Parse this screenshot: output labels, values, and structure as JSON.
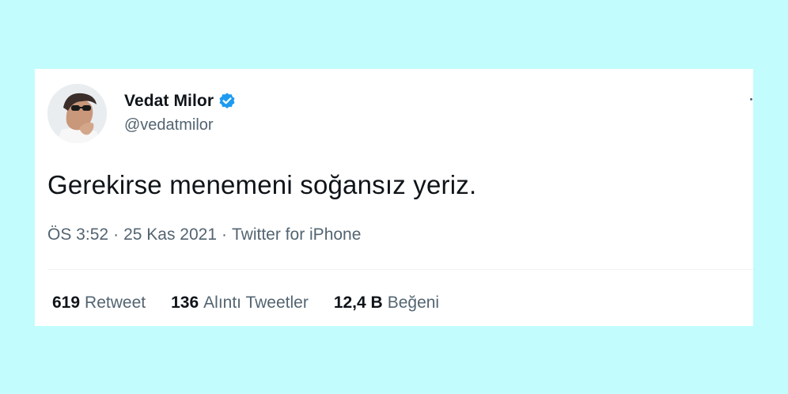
{
  "colors": {
    "page_background": "#c2fcfd",
    "card_background": "#ffffff",
    "text_primary": "#0f1419",
    "text_secondary": "#536471",
    "verified_badge": "#1d9bf0"
  },
  "tweet": {
    "author": {
      "display_name": "Vedat Milor",
      "handle": "@vedatmilor",
      "verified": true,
      "avatar_icon": "profile-photo"
    },
    "text": "Gerekirse menemeni soğansız yeriz.",
    "meta": {
      "time": "ÖS 3:52",
      "separator": "·",
      "date": "25 Kas 2021",
      "source": "Twitter for iPhone"
    },
    "stats": [
      {
        "count": "619",
        "label": "Retweet"
      },
      {
        "count": "136",
        "label": "Alıntı Tweetler"
      },
      {
        "count": "12,4 B",
        "label": "Beğeni"
      }
    ]
  }
}
